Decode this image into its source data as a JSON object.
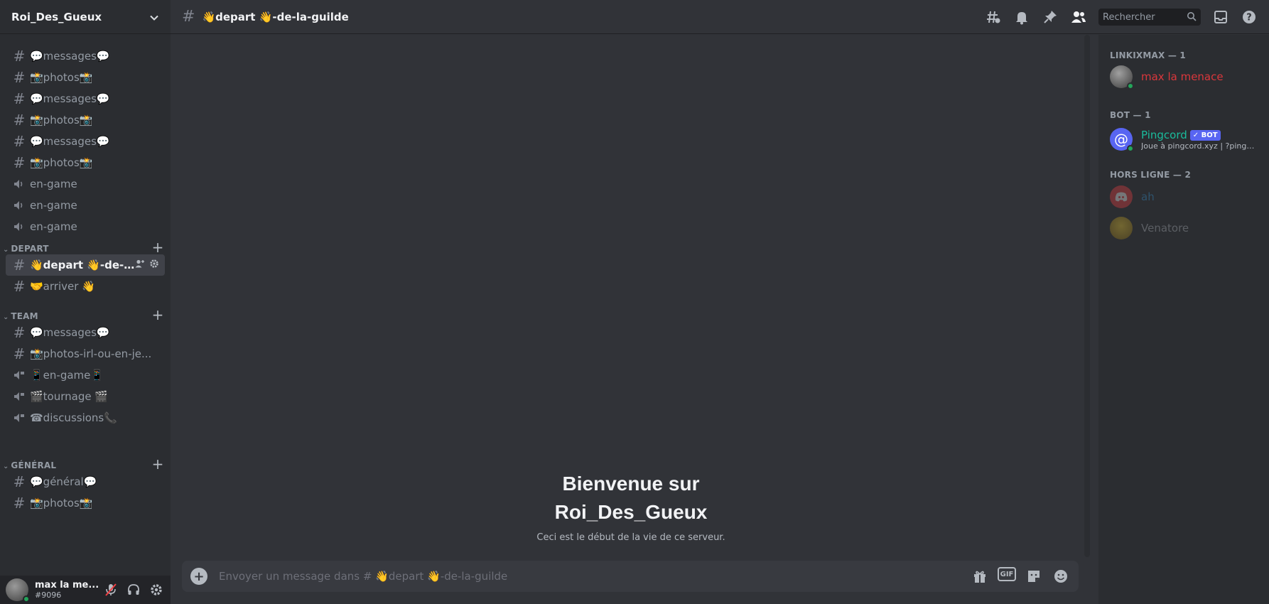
{
  "server": {
    "name": "Roi_Des_Gueux"
  },
  "channels_top": [
    {
      "type": "text",
      "label": "💬messages💬"
    },
    {
      "type": "text",
      "label": "📸photos📸"
    },
    {
      "type": "text",
      "label": "💬messages💬"
    },
    {
      "type": "text",
      "label": "📸photos📸"
    },
    {
      "type": "text",
      "label": "💬messages💬"
    },
    {
      "type": "text",
      "label": "📸photos📸"
    },
    {
      "type": "voice",
      "label": "en-game"
    },
    {
      "type": "voice",
      "label": "en-game"
    },
    {
      "type": "voice",
      "label": "en-game"
    }
  ],
  "categories": {
    "depart": "DEPART",
    "team": "TEAM",
    "general": "GÉNÉRAL"
  },
  "depart_channels": [
    {
      "label": "👋depart 👋-de-l..."
    },
    {
      "label": "🤝arriver 👋"
    }
  ],
  "team_channels": [
    {
      "label": "💬messages💬"
    },
    {
      "label": "📸photos-irl-ou-en-je..."
    },
    {
      "label": "📱en-game📱"
    },
    {
      "label": "🎬tournage 🎬"
    },
    {
      "label": "☎discussions📞"
    }
  ],
  "general_channels": [
    {
      "label": "💬général💬"
    },
    {
      "label": "📸photos📸"
    }
  ],
  "user": {
    "name": "max la me...",
    "tag": "#9096"
  },
  "topbar": {
    "channel_title": "👋depart 👋-de-la-guilde",
    "search_placeholder": "Rechercher"
  },
  "welcome": {
    "title_line1": "Bienvenue sur",
    "title_line2": "Roi_Des_Gueux",
    "subtitle": "Ceci est le début de la vie de ce serveur."
  },
  "composer": {
    "placeholder": "Envoyer un message dans # 👋depart 👋-de-la-guilde",
    "gif_label": "GIF"
  },
  "members": {
    "groups": [
      {
        "title": "LINKIXMAX — 1",
        "members": [
          {
            "name": "max la menace",
            "color": "#da373c",
            "status": "online"
          }
        ]
      },
      {
        "title": "BOT — 1",
        "members": [
          {
            "name": "Pingcord",
            "color": "#1abc9c",
            "badge": "✓ BOT",
            "activity": "Joue à pingcord.xyz | ?pingco...",
            "status": "online"
          }
        ]
      },
      {
        "title": "HORS LIGNE — 2",
        "members": [
          {
            "name": "ah",
            "color": "#3498db",
            "status": "offline"
          },
          {
            "name": "Venatore",
            "color": "#b5bac1",
            "status": "offline"
          }
        ]
      }
    ]
  },
  "colors": {
    "accent": "#5865f2",
    "online": "#23a55a"
  }
}
